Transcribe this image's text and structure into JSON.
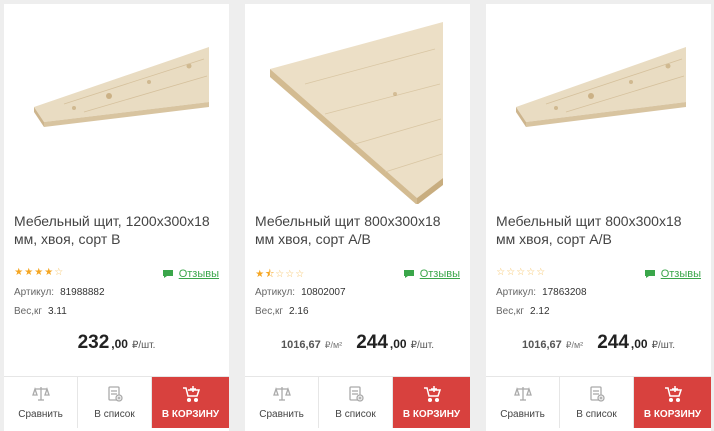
{
  "products": [
    {
      "title": "Мебельный щит, 1200х300х18 мм, хвоя, сорт В",
      "rating": 4,
      "reviews_label": "Отзывы",
      "article_label": "Артикул:",
      "article": "81988882",
      "weight_label": "Вес,кг",
      "weight": "3.11",
      "alt_price": "",
      "alt_unit": "",
      "price_main": "232",
      "price_cents": ",00",
      "price_unit": "₽/шт.",
      "compare_label": "Сравнить",
      "list_label": "В список",
      "cart_label": "В КОРЗИНУ",
      "image_icon": "board-image-long"
    },
    {
      "title": "Мебельный щит 800х300х18 мм хвоя, сорт А/В",
      "rating": 1.5,
      "reviews_label": "Отзывы",
      "article_label": "Артикул:",
      "article": "10802007",
      "weight_label": "Вес,кг",
      "weight": "2.16",
      "alt_price": "1016,67",
      "alt_unit": "₽/м²",
      "price_main": "244",
      "price_cents": ",00",
      "price_unit": "₽/шт.",
      "compare_label": "Сравнить",
      "list_label": "В список",
      "cart_label": "В КОРЗИНУ",
      "image_icon": "board-image-wide"
    },
    {
      "title": "Мебельный щит 800х300х18 мм хвоя, сорт А/В",
      "rating": 0,
      "reviews_label": "Отзывы",
      "article_label": "Артикул:",
      "article": "17863208",
      "weight_label": "Вес,кг",
      "weight": "2.12",
      "alt_price": "1016,67",
      "alt_unit": "₽/м²",
      "price_main": "244",
      "price_cents": ",00",
      "price_unit": "₽/шт.",
      "compare_label": "Сравнить",
      "list_label": "В список",
      "cart_label": "В КОРЗИНУ",
      "image_icon": "board-image-long"
    }
  ],
  "colors": {
    "cart_button": "#d8413e",
    "reviews_link": "#3aa64a",
    "star": "#f5a623",
    "wood_top": "#e8dcc4",
    "wood_edge": "#d9c7a4"
  }
}
